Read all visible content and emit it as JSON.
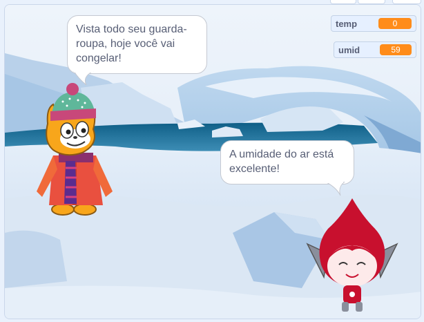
{
  "monitors": {
    "temp": {
      "name": "temp",
      "value": "0"
    },
    "umid": {
      "name": "umid",
      "value": "59"
    }
  },
  "bubbles": {
    "cat": "Vista todo seu guarda-roupa, hoje você vai congelar!",
    "pico": "A umidade do ar está excelente!"
  },
  "colors": {
    "monitor_value": "#ff8c1a",
    "bubble_text": "#575e75",
    "sky": "#eaf2fb",
    "water": "#1c6f97",
    "ice": "#d8e7f6"
  },
  "icons": {
    "backdrop": "arctic-backdrop",
    "cat_sprite": "scratch-cat-winter-costume",
    "pico_sprite": "red-pico-character"
  }
}
